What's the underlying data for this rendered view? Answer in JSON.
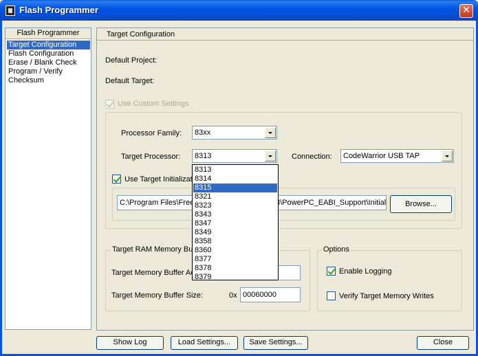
{
  "window": {
    "title": "Flash Programmer",
    "close_glyph": "✕"
  },
  "nav": {
    "header": "Flash Programmer",
    "items": [
      {
        "label": "Target Configuration",
        "selected": true
      },
      {
        "label": "Flash Configuration"
      },
      {
        "label": "Erase / Blank Check"
      },
      {
        "label": "Program / Verify"
      },
      {
        "label": "Checksum"
      }
    ]
  },
  "panel": {
    "header": "Target Configuration",
    "default_project_label": "Default Project:",
    "default_target_label": "Default Target:",
    "use_custom_settings": {
      "label": "Use Custom Settings",
      "checked": true,
      "enabled": false
    },
    "processor_family": {
      "label": "Processor Family:",
      "value": "83xx"
    },
    "target_processor": {
      "label": "Target Processor:",
      "value": "8313"
    },
    "connection": {
      "label": "Connection:",
      "value": "CodeWarrior USB TAP"
    },
    "use_target_init": {
      "label": "Use Target Initializati",
      "checked": true
    },
    "init_path": {
      "value_left": "C:\\Program Files\\Free",
      "value_right": "8\\PowerPC_EABI_Support\\Initial"
    },
    "browse_label": "Browse...",
    "ram_buffer": {
      "title": "Target RAM Memory Buff",
      "address_label": "Target Memory Buffer Ac",
      "size_label": "Target Memory Buffer Size:",
      "size_prefix": "0x",
      "size_value": "00060000"
    },
    "options": {
      "title": "Options",
      "enable_logging": {
        "label": "Enable Logging",
        "checked": true
      },
      "verify_writes": {
        "label": "Verify Target Memory Writes",
        "checked": false
      }
    }
  },
  "processor_dropdown": {
    "items": [
      "8313",
      "8314",
      "8315",
      "8321",
      "8323",
      "8343",
      "8347",
      "8349",
      "8358",
      "8360",
      "8377",
      "8378",
      "8379"
    ],
    "highlighted_index": 2
  },
  "buttons": {
    "show_log": "Show Log",
    "load_settings": "Load Settings...",
    "save_settings": "Save Settings...",
    "close": "Close"
  },
  "colors": {
    "titlebar": "#0054e3",
    "selection": "#316ac5",
    "window_bg": "#ece9d8"
  }
}
